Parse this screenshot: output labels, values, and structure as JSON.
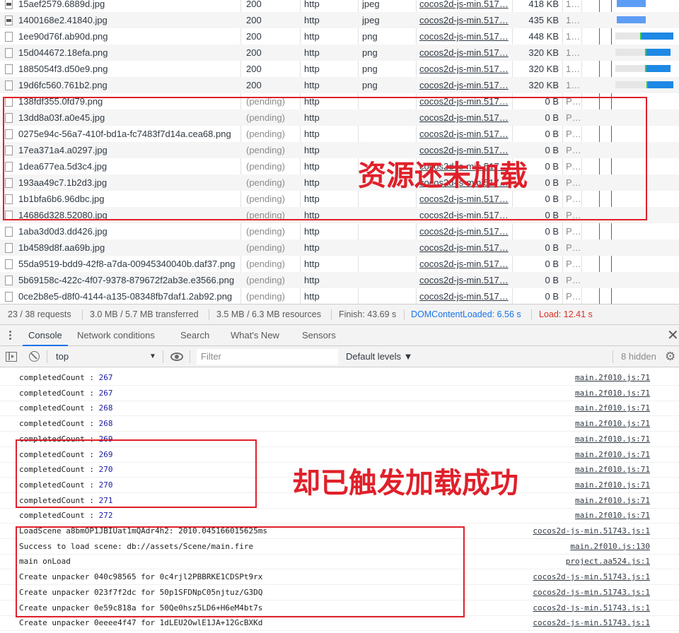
{
  "network": {
    "rows": [
      {
        "name": "15aef2579.6889d.jpg",
        "status": "200",
        "protocol": "http",
        "type": "jpeg",
        "initiator": "cocos2d-js-min.517…",
        "size": "418 KB",
        "time": "1…",
        "state": "done",
        "icon": "img"
      },
      {
        "name": "1400168e2.41840.jpg",
        "status": "200",
        "protocol": "http",
        "type": "jpeg",
        "initiator": "cocos2d-js-min.517…",
        "size": "435 KB",
        "time": "1…",
        "state": "done",
        "icon": "img"
      },
      {
        "name": "1ee90d76f.ab90d.png",
        "status": "200",
        "protocol": "http",
        "type": "png",
        "initiator": "cocos2d-js-min.517…",
        "size": "448 KB",
        "time": "1…",
        "state": "done",
        "icon": "file"
      },
      {
        "name": "15d044672.18efa.png",
        "status": "200",
        "protocol": "http",
        "type": "png",
        "initiator": "cocos2d-js-min.517…",
        "size": "320 KB",
        "time": "1…",
        "state": "done",
        "icon": "file"
      },
      {
        "name": "1885054f3.d50e9.png",
        "status": "200",
        "protocol": "http",
        "type": "png",
        "initiator": "cocos2d-js-min.517…",
        "size": "320 KB",
        "time": "1…",
        "state": "done",
        "icon": "file"
      },
      {
        "name": "19d6fc560.761b2.png",
        "status": "200",
        "protocol": "http",
        "type": "png",
        "initiator": "cocos2d-js-min.517…",
        "size": "320 KB",
        "time": "1…",
        "state": "done",
        "icon": "file"
      },
      {
        "name": "138fdf355.0fd79.png",
        "status": "(pending)",
        "protocol": "http",
        "type": "",
        "initiator": "cocos2d-js-min.517…",
        "size": "0 B",
        "time": "P…",
        "state": "pending",
        "icon": "file"
      },
      {
        "name": "13dd8a03f.a0e45.jpg",
        "status": "(pending)",
        "protocol": "http",
        "type": "",
        "initiator": "cocos2d-js-min.517…",
        "size": "0 B",
        "time": "P…",
        "state": "pending",
        "icon": "file"
      },
      {
        "name": "0275e94c-56a7-410f-bd1a-fc7483f7d14a.cea68.png",
        "status": "(pending)",
        "protocol": "http",
        "type": "",
        "initiator": "cocos2d-js-min.517…",
        "size": "0 B",
        "time": "P…",
        "state": "pending",
        "icon": "file"
      },
      {
        "name": "17ea371a4.a0297.jpg",
        "status": "(pending)",
        "protocol": "http",
        "type": "",
        "initiator": "cocos2d-js-min.517…",
        "size": "0 B",
        "time": "P…",
        "state": "pending",
        "icon": "file"
      },
      {
        "name": "1dea677ea.5d3c4.jpg",
        "status": "(pending)",
        "protocol": "http",
        "type": "",
        "initiator": "cocos2d-js-min.517…",
        "size": "0 B",
        "time": "P…",
        "state": "pending",
        "icon": "file"
      },
      {
        "name": "193aa49c7.1b2d3.jpg",
        "status": "(pending)",
        "protocol": "http",
        "type": "",
        "initiator": "cocos2d-js-min.517…",
        "size": "0 B",
        "time": "P…",
        "state": "pending",
        "icon": "file"
      },
      {
        "name": "1b1bfa6b6.96dbc.jpg",
        "status": "(pending)",
        "protocol": "http",
        "type": "",
        "initiator": "cocos2d-js-min.517…",
        "size": "0 B",
        "time": "P…",
        "state": "pending",
        "icon": "file"
      },
      {
        "name": "14686d328.52080.jpg",
        "status": "(pending)",
        "protocol": "http",
        "type": "",
        "initiator": "cocos2d-js-min.517…",
        "size": "0 B",
        "time": "P…",
        "state": "pending",
        "icon": "file"
      },
      {
        "name": "1aba3d0d3.dd426.jpg",
        "status": "(pending)",
        "protocol": "http",
        "type": "",
        "initiator": "cocos2d-js-min.517…",
        "size": "0 B",
        "time": "P…",
        "state": "pending",
        "icon": "file"
      },
      {
        "name": "1b4589d8f.aa69b.jpg",
        "status": "(pending)",
        "protocol": "http",
        "type": "",
        "initiator": "cocos2d-js-min.517…",
        "size": "0 B",
        "time": "P…",
        "state": "pending",
        "icon": "file"
      },
      {
        "name": "55da9519-bdd9-42f8-a7da-00945340040b.daf37.png",
        "status": "(pending)",
        "protocol": "http",
        "type": "",
        "initiator": "cocos2d-js-min.517…",
        "size": "0 B",
        "time": "P…",
        "state": "pending",
        "icon": "file"
      },
      {
        "name": "5b69158c-422c-4f07-9378-879672f2ab3e.e3566.png",
        "status": "(pending)",
        "protocol": "http",
        "type": "",
        "initiator": "cocos2d-js-min.517…",
        "size": "0 B",
        "time": "P…",
        "state": "pending",
        "icon": "file"
      },
      {
        "name": "0ce2b8e5-d8f0-4144-a135-08348fb7daf1.2ab92.png",
        "status": "(pending)",
        "protocol": "http",
        "type": "",
        "initiator": "cocos2d-js-min.517…",
        "size": "0 B",
        "time": "P…",
        "state": "pending",
        "icon": "file"
      }
    ]
  },
  "summary": {
    "requests": "23 / 38 requests",
    "transferred": "3.0 MB / 5.7 MB transferred",
    "resources": "3.5 MB / 6.3 MB resources",
    "finish": "Finish: 43.69 s",
    "dcl": "DOMContentLoaded: 6.56 s",
    "load": "Load: 12.41 s",
    "dcl_color": "#1a73e8",
    "load_color": "#d93025"
  },
  "drawer": {
    "tabs": [
      "Console",
      "Network conditions",
      "Search",
      "What's New",
      "Sensors"
    ],
    "active_tab": "Console",
    "close_label": "✕"
  },
  "console_toolbar": {
    "context": "top",
    "filter_placeholder": "Filter",
    "levels": "Default levels ▼",
    "hidden": "8 hidden"
  },
  "console": {
    "messages": [
      {
        "label": "completedCount : ",
        "value": "267",
        "source": "main.2f010.js:71"
      },
      {
        "label": "completedCount : ",
        "value": "267",
        "source": "main.2f010.js:71"
      },
      {
        "label": "completedCount : ",
        "value": "268",
        "source": "main.2f010.js:71"
      },
      {
        "label": "completedCount : ",
        "value": "268",
        "source": "main.2f010.js:71"
      },
      {
        "label": "completedCount : ",
        "value": "269",
        "source": "main.2f010.js:71"
      },
      {
        "label": "completedCount : ",
        "value": "269",
        "source": "main.2f010.js:71"
      },
      {
        "label": "completedCount : ",
        "value": "270",
        "source": "main.2f010.js:71"
      },
      {
        "label": "completedCount : ",
        "value": "270",
        "source": "main.2f010.js:71"
      },
      {
        "label": "completedCount : ",
        "value": "271",
        "source": "main.2f010.js:71"
      },
      {
        "label": "completedCount : ",
        "value": "272",
        "source": "main.2f010.js:71"
      },
      {
        "label": "LoadScene a8bmOP1JBIUat1mQAdr4h2: 2010.045166015625ms",
        "value": "",
        "source": "cocos2d-js-min.51743.js:1"
      },
      {
        "label": "Success to load scene: db://assets/Scene/main.fire",
        "value": "",
        "source": "main.2f010.js:130"
      },
      {
        "label": "main onLoad",
        "value": "",
        "source": "project.aa524.js:1"
      },
      {
        "label": "Create unpacker 040c98565 for 0c4rjl2PBBRKE1CDSPt9rx",
        "value": "",
        "source": "cocos2d-js-min.51743.js:1"
      },
      {
        "label": "Create unpacker 023f7f2dc for 50p1SFDNpC05njtuz/G3DQ",
        "value": "",
        "source": "cocos2d-js-min.51743.js:1"
      },
      {
        "label": "Create unpacker 0e59c818a for 50Qe0hsz5LD6+H6eM4bt7s",
        "value": "",
        "source": "cocos2d-js-min.51743.js:1"
      },
      {
        "label": "Create unpacker 0eeee4f47 for 1dLEU2OwlE1JA+12GcBXKd",
        "value": "",
        "source": "cocos2d-js-min.51743.js:1"
      }
    ]
  },
  "annotations": {
    "resources_not_loaded": "资源还未加载",
    "load_success_triggered": "却已触发加载成功",
    "color": "#e0202a"
  }
}
